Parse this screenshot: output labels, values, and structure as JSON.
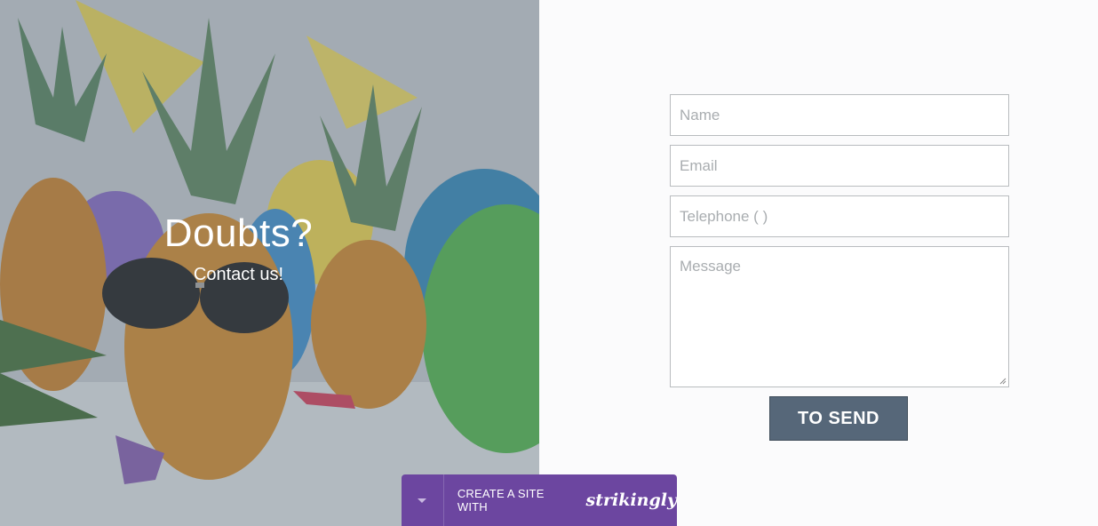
{
  "hero": {
    "title": "Doubts?",
    "subtitle": "Contact us!"
  },
  "form": {
    "name_placeholder": "Name",
    "email_placeholder": "Email",
    "telephone_placeholder": "Telephone ( )",
    "message_placeholder": "Message",
    "send_label": "TO SEND"
  },
  "badge": {
    "text": "CREATE A SITE WITH",
    "brand": "strikingly"
  },
  "colors": {
    "button": "#566779",
    "badge": "#6c46a0",
    "background": "#fbfbfc"
  }
}
